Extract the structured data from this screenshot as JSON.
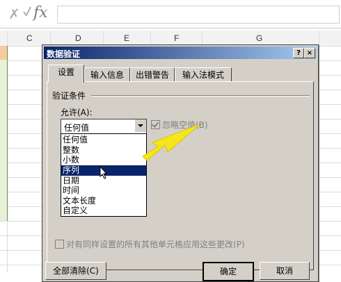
{
  "formula_bar": {
    "cancel_glyph": "✗",
    "fx_label": "fx",
    "value": ""
  },
  "columns": [
    "C",
    "D",
    "E",
    "F",
    "G"
  ],
  "dialog": {
    "title": "数据验证",
    "help_btn": "?",
    "close_btn": "×",
    "tabs": [
      "设置",
      "输入信息",
      "出错警告",
      "输入法模式"
    ],
    "active_tab": 0,
    "group_label": "验证条件",
    "allow_label": "允许(A):",
    "allow_value": "任何值",
    "ignore_blank_label": "忽略空值(B)",
    "dropdown_items": [
      "任何值",
      "整数",
      "小数",
      "序列",
      "日期",
      "时间",
      "文本长度",
      "自定义"
    ],
    "selected_item": 3,
    "apply_all_label": "对有同样设置的所有其他单元格应用这些更改(P)",
    "buttons": {
      "clear_all": "全部清除(C)",
      "ok": "确定",
      "cancel": "取消"
    }
  },
  "colors": {
    "title_start": "#0a246a",
    "title_end": "#a6caf0",
    "selection": "#0a246a",
    "arrow": "#f5e61b"
  }
}
